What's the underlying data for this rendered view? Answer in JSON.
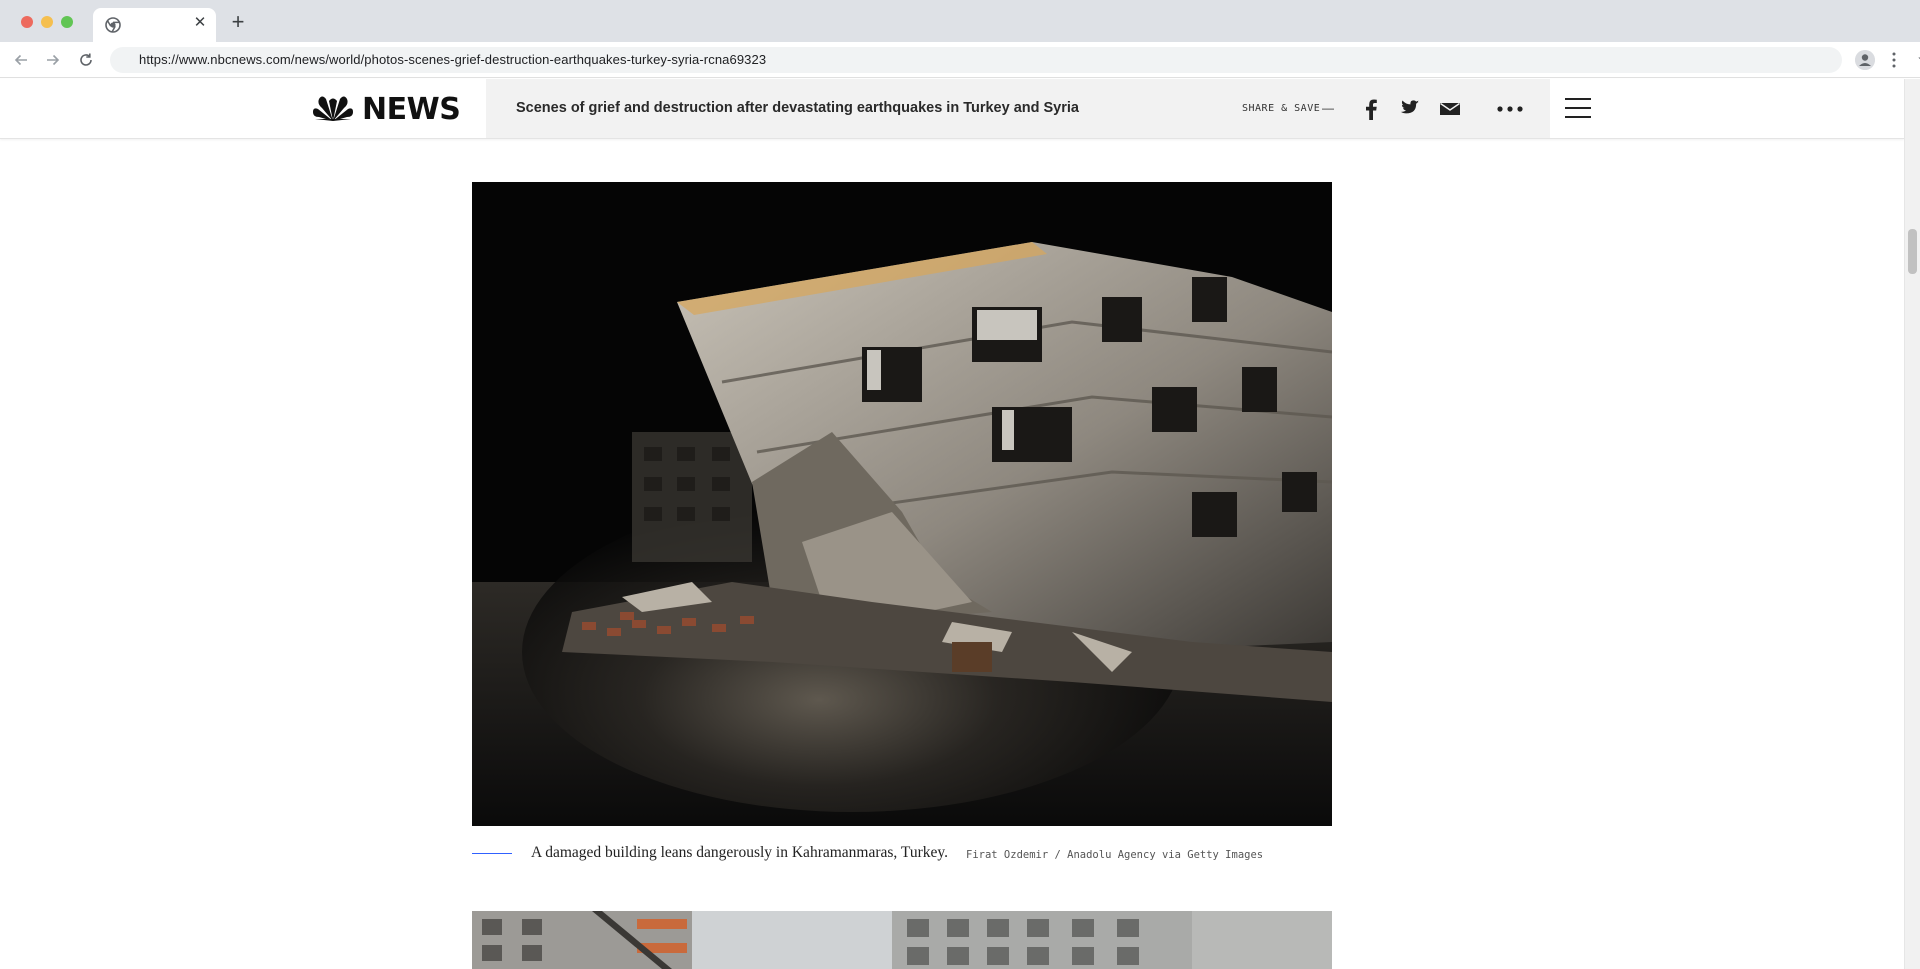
{
  "browser": {
    "url": "https://www.nbcnews.com/news/world/photos-scenes-grief-destruction-earthquakes-turkey-syria-rcna69323",
    "tab_close": "✕",
    "new_tab": "+"
  },
  "header": {
    "logo_text": "NEWS",
    "story_title": "Scenes of grief and destruction after devastating earthquakes in Turkey and Syria",
    "share_label": "SHARE & SAVE",
    "share_dash": "—"
  },
  "photo": {
    "caption": "A damaged building leans dangerously in Kahramanmaras, Turkey.",
    "credit": "Firat Ozdemir / Anadolu Agency via Getty Images"
  },
  "colors": {
    "caption_rule": "#3061ff",
    "title_panel": "#f2f2f2"
  }
}
